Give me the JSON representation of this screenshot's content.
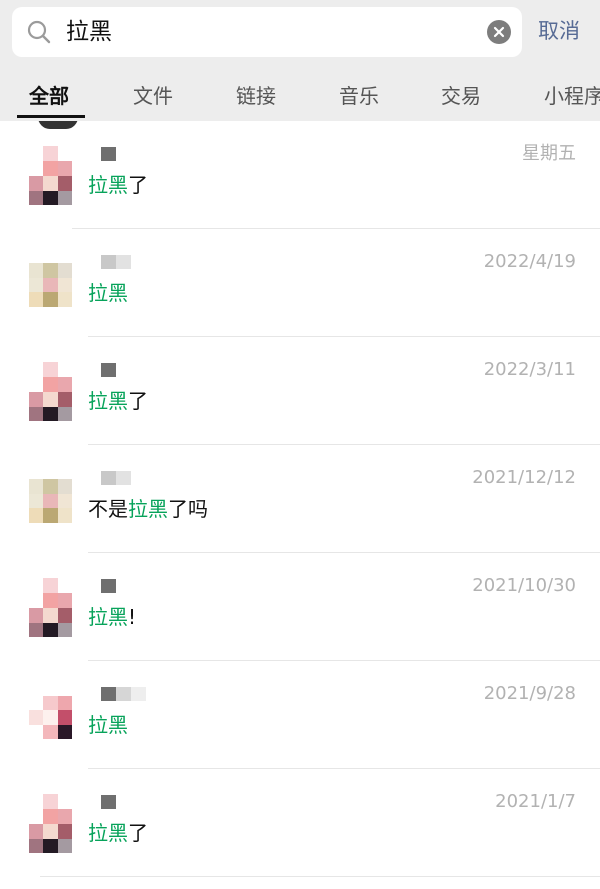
{
  "search": {
    "query": "拉黑",
    "cancel_label": "取消"
  },
  "tabs": [
    {
      "label": "全部",
      "active": true
    },
    {
      "label": "文件",
      "active": false
    },
    {
      "label": "链接",
      "active": false
    },
    {
      "label": "音乐",
      "active": false
    },
    {
      "label": "交易",
      "active": false
    },
    {
      "label": "小程序",
      "active": false
    }
  ],
  "results": [
    {
      "avatar": "pink-pixel-avatar",
      "date": "星期五",
      "msg_prefix": "",
      "keyword": "拉黑",
      "msg_suffix": "了"
    },
    {
      "avatar": "beige-pixel-avatar",
      "date": "2022/4/19",
      "msg_prefix": "",
      "keyword": "拉黑",
      "msg_suffix": ""
    },
    {
      "avatar": "pink-pixel-avatar",
      "date": "2022/3/11",
      "msg_prefix": "",
      "keyword": "拉黑",
      "msg_suffix": "了"
    },
    {
      "avatar": "beige-pixel-avatar",
      "date": "2021/12/12",
      "msg_prefix": "不是",
      "keyword": "拉黑",
      "msg_suffix": "了吗"
    },
    {
      "avatar": "pink-pixel-avatar",
      "date": "2021/10/30",
      "msg_prefix": "",
      "keyword": "拉黑",
      "msg_suffix": "!"
    },
    {
      "avatar": "rose-pixel-avatar",
      "date": "2021/9/28",
      "msg_prefix": "",
      "keyword": "拉黑",
      "msg_suffix": ""
    },
    {
      "avatar": "pink-pixel-avatar",
      "date": "2021/1/7",
      "msg_prefix": "",
      "keyword": "拉黑",
      "msg_suffix": "了"
    }
  ],
  "colors": {
    "topbar_bg": "#ededed",
    "keyword_highlight": "#07a35a",
    "cancel_link": "#576b95",
    "date_text": "#b2b2b2"
  }
}
